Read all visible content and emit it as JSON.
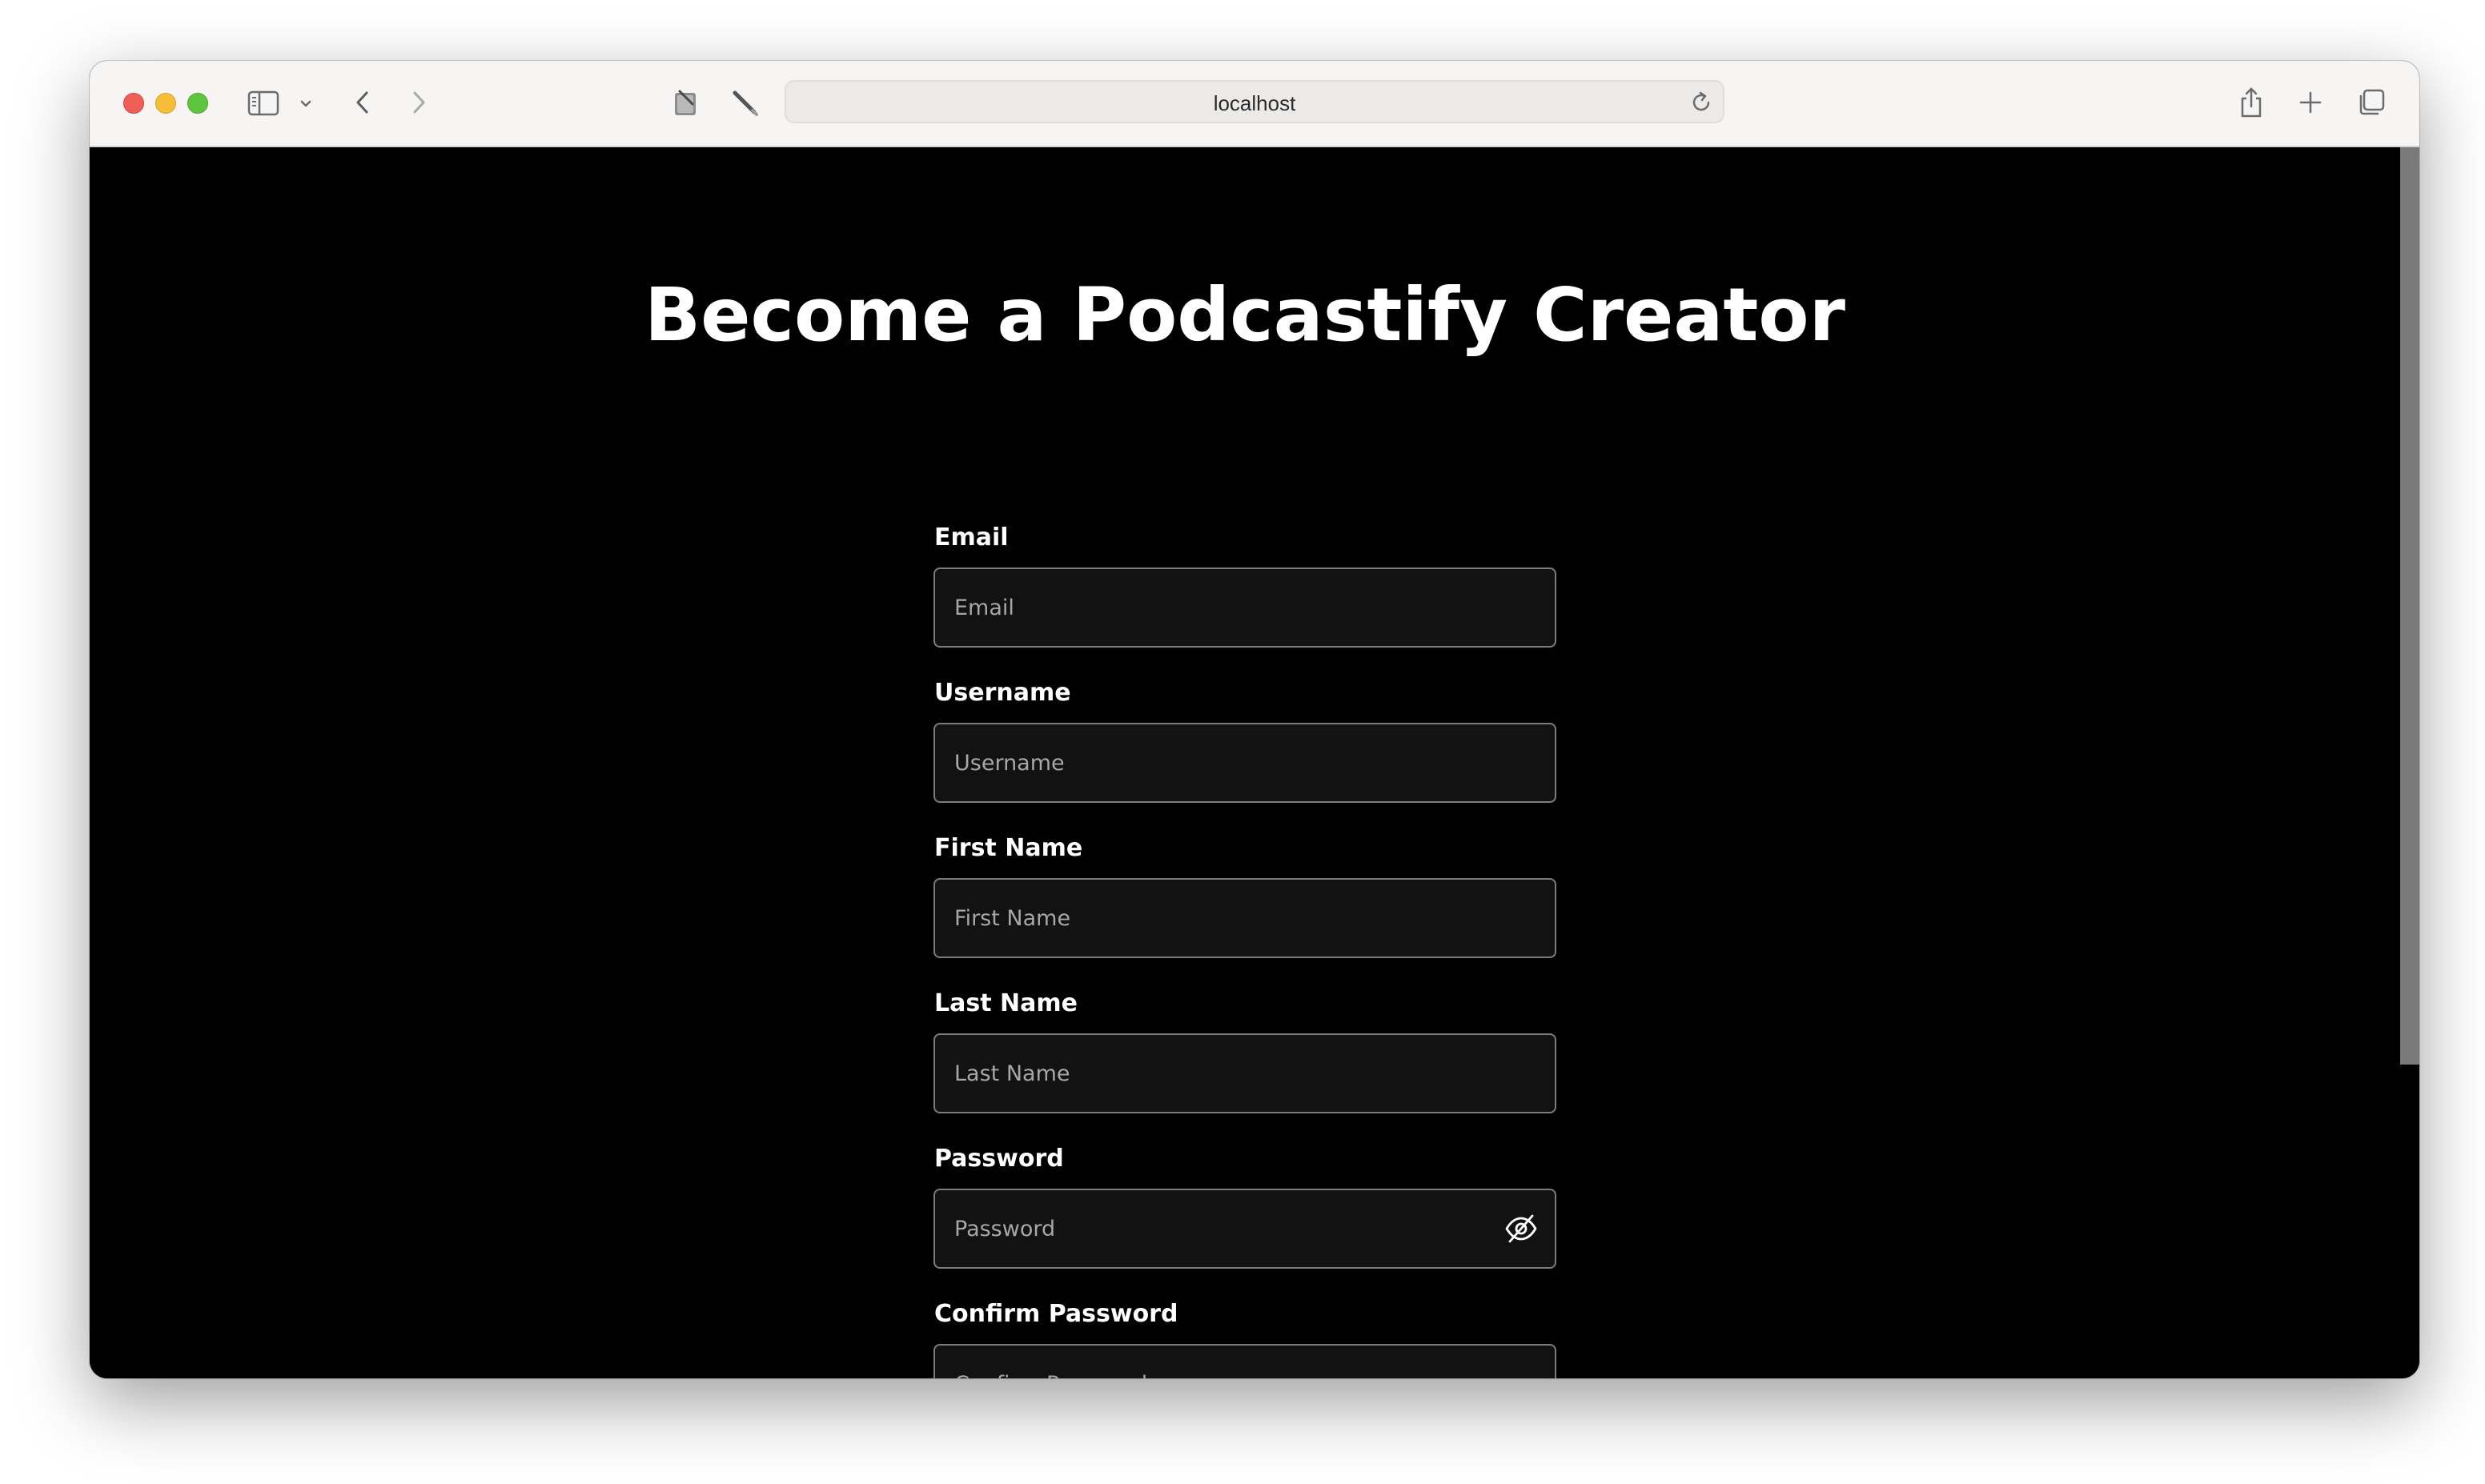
{
  "browser": {
    "address": "localhost",
    "icons": {
      "sidebar": "sidebar-icon",
      "chevron": "chevron-down-icon",
      "back": "back-arrow-icon",
      "forward": "forward-arrow-icon",
      "extension1": "note-extension-icon",
      "extension2": "pen-tool-icon",
      "reload": "reload-icon",
      "share": "share-icon",
      "new_tab": "plus-icon",
      "tabs": "tabs-overview-icon"
    }
  },
  "page": {
    "title": "Become a Podcastify Creator",
    "form": {
      "email": {
        "label": "Email",
        "placeholder": "Email"
      },
      "username": {
        "label": "Username",
        "placeholder": "Username"
      },
      "first_name": {
        "label": "First Name",
        "placeholder": "First Name"
      },
      "last_name": {
        "label": "Last Name",
        "placeholder": "Last Name"
      },
      "password": {
        "label": "Password",
        "placeholder": "Password",
        "toggle_icon": "eye-slash-icon"
      },
      "confirm_password": {
        "label": "Confirm Password",
        "placeholder": "Confirm Password"
      }
    }
  },
  "colors": {
    "background": "#000000",
    "input_background": "#121212",
    "input_border": "#7c7c7c",
    "placeholder": "#a7a7a7",
    "text": "#ffffff"
  }
}
